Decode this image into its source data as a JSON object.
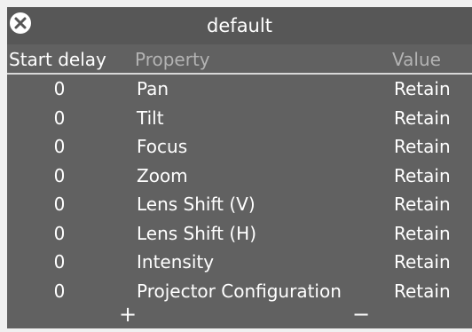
{
  "window": {
    "title": "default"
  },
  "columns": {
    "start_delay": "Start delay",
    "property": "Property",
    "value": "Value"
  },
  "rows": [
    {
      "start_delay": "0",
      "property": "Pan",
      "value": "Retain"
    },
    {
      "start_delay": "0",
      "property": "Tilt",
      "value": "Retain"
    },
    {
      "start_delay": "0",
      "property": "Focus",
      "value": "Retain"
    },
    {
      "start_delay": "0",
      "property": "Zoom",
      "value": "Retain"
    },
    {
      "start_delay": "0",
      "property": "Lens Shift (V)",
      "value": "Retain"
    },
    {
      "start_delay": "0",
      "property": "Lens Shift (H)",
      "value": "Retain"
    },
    {
      "start_delay": "0",
      "property": "Intensity",
      "value": "Retain"
    },
    {
      "start_delay": "0",
      "property": "Projector Configuration",
      "value": "Retain"
    }
  ],
  "footer": {
    "add_label": "+",
    "remove_label": "−"
  },
  "icons": {
    "close": "close-icon"
  },
  "colors": {
    "panel": "#616161",
    "titlebar": "#575757",
    "text": "#ffffff",
    "muted_header": "#b3b3b3"
  }
}
